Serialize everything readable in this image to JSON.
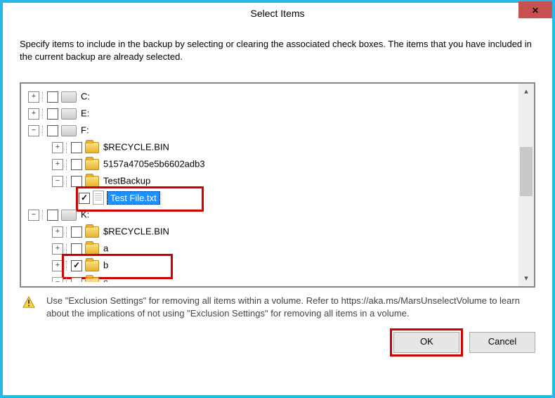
{
  "dialog": {
    "title": "Select Items",
    "description": "Specify items to include in the backup by selecting or clearing the associated check boxes. The items that you have included in the current backup are already selected."
  },
  "tree": {
    "drive_c": "C:",
    "drive_e": "E:",
    "drive_f": "F:",
    "f_recycle": "$RECYCLE.BIN",
    "f_guid": "5157a4705e5b6602adb3",
    "f_testbackup": "TestBackup",
    "f_testfile": "Test File.txt",
    "drive_k": "K:",
    "k_recycle": "$RECYCLE.BIN",
    "k_a": "a",
    "k_b": "b",
    "k_c": "c"
  },
  "hint": {
    "text": "Use \"Exclusion Settings\" for removing all items within a volume. Refer to https://aka.ms/MarsUnselectVolume to learn about the implications of not using \"Exclusion Settings\" for removing all items in a volume."
  },
  "buttons": {
    "ok": "OK",
    "cancel": "Cancel"
  }
}
